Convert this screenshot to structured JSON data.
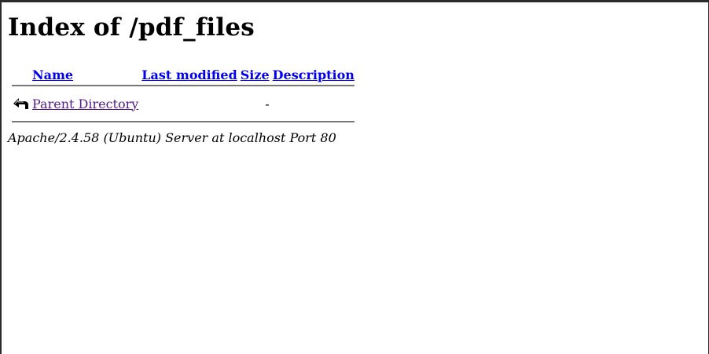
{
  "page": {
    "title": "Index of /pdf_files"
  },
  "table": {
    "headers": {
      "name": "Name",
      "last_modified": "Last modified",
      "size": "Size",
      "description": "Description"
    },
    "rows": [
      {
        "icon": "back-arrow-icon",
        "name": "Parent Directory",
        "last_modified": "",
        "size": "-",
        "description": ""
      }
    ]
  },
  "footer": {
    "address": "Apache/2.4.58 (Ubuntu) Server at localhost Port 80"
  },
  "colors": {
    "link": "#0000ee",
    "visited_link": "#551a8b",
    "rule": "#777777",
    "window_frame": "#2b2b2b"
  }
}
